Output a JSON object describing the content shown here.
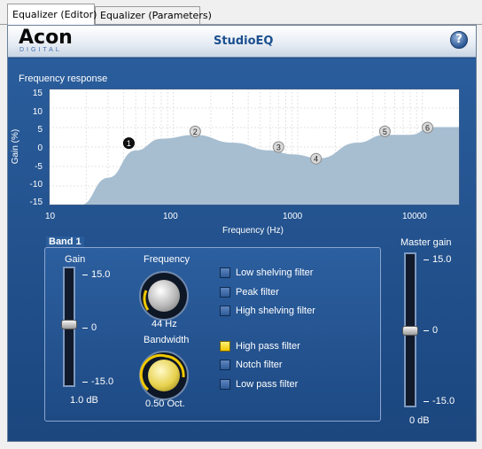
{
  "tabs": [
    {
      "label": "Equalizer (Editor)",
      "active": true
    },
    {
      "label": "Equalizer (Parameters)",
      "active": false
    }
  ],
  "header": {
    "logo_main": "Acon",
    "logo_sub": "DIGITAL",
    "title": "StudioEQ",
    "help_label": "?"
  },
  "plot": {
    "title": "Frequency response",
    "ylabel": "Gain (%)",
    "xlabel": "Frequency (Hz)",
    "yticks": [
      "15",
      "10",
      "5",
      "0",
      "-5",
      "-10",
      "-15"
    ],
    "xticks": [
      "10",
      "100",
      "1000",
      "10000"
    ]
  },
  "chart_data": {
    "type": "area",
    "title": "Frequency response",
    "xlabel": "Frequency (Hz)",
    "ylabel": "Gain (%)",
    "x_scale": "log",
    "xlim": [
      10,
      20000
    ],
    "ylim": [
      -15,
      15
    ],
    "grid": true,
    "x": [
      10,
      18,
      30,
      50,
      80,
      150,
      300,
      600,
      900,
      1500,
      3000,
      5000,
      8000,
      12000,
      20000
    ],
    "y": [
      -15,
      -15,
      -8,
      -1,
      2,
      3,
      1,
      -1,
      -2,
      -3,
      1,
      3,
      3,
      5,
      5
    ],
    "bands": [
      {
        "label": "1",
        "freq": 44,
        "gain": 1.0,
        "selected": true
      },
      {
        "label": "2",
        "freq": 150,
        "gain": 4
      },
      {
        "label": "3",
        "freq": 700,
        "gain": 0
      },
      {
        "label": "4",
        "freq": 1400,
        "gain": -3
      },
      {
        "label": "5",
        "freq": 5000,
        "gain": 4
      },
      {
        "label": "6",
        "freq": 11000,
        "gain": 5
      }
    ]
  },
  "band": {
    "title": "Band 1",
    "gain_label": "Gain",
    "gain_ticks": [
      "15.0",
      "0",
      "-15.0"
    ],
    "gain_value": "1.0 dB",
    "gain_level_db": 1.0,
    "frequency_label": "Frequency",
    "frequency_value": "44 Hz",
    "bandwidth_label": "Bandwidth",
    "bandwidth_value": "0.50 Oct.",
    "filters": [
      {
        "label": "Low shelving filter",
        "checked": false
      },
      {
        "label": "Peak filter",
        "checked": false
      },
      {
        "label": "High shelving filter",
        "checked": false
      },
      {
        "label": "High pass filter",
        "checked": true
      },
      {
        "label": "Notch filter",
        "checked": false
      },
      {
        "label": "Low pass filter",
        "checked": false
      }
    ]
  },
  "master": {
    "label": "Master gain",
    "ticks": [
      "15.0",
      "0",
      "-15.0"
    ],
    "value": "0 dB",
    "level_db": 0
  },
  "colors": {
    "panel": "#1d4c86",
    "curve_fill": "#a7bed1",
    "accent": "#1c4f8f",
    "checked": "#f0c800"
  }
}
